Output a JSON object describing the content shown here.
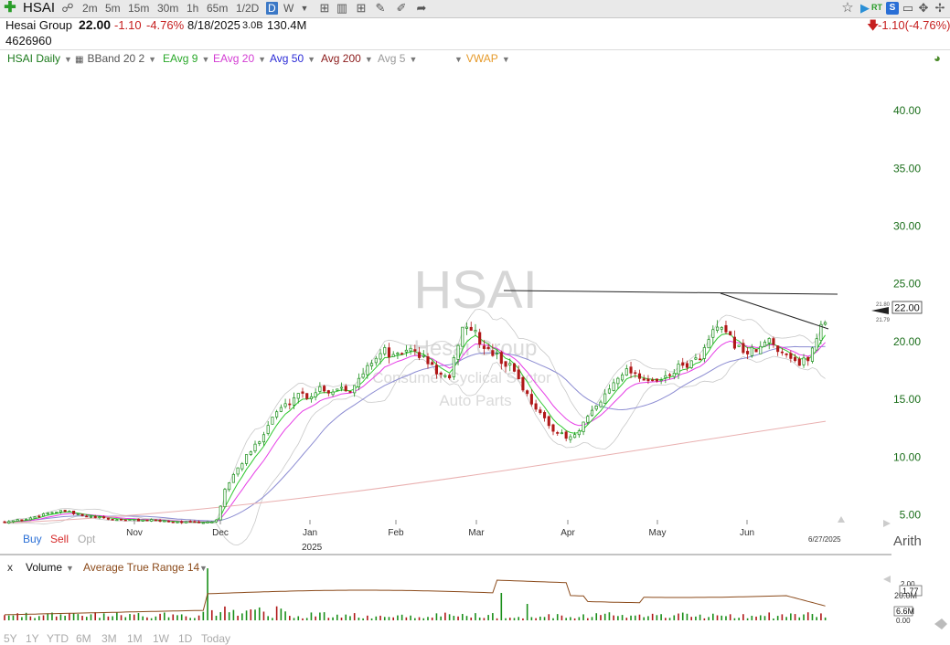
{
  "toolbar": {
    "symbol": "HSAI",
    "timeframes": [
      "2m",
      "5m",
      "15m",
      "30m",
      "1h",
      "65m",
      "1/2D",
      "D",
      "W"
    ],
    "selected_timeframe": "D",
    "rt_label": "RT",
    "sp_label": "S"
  },
  "quote": {
    "name": "Hesai Group",
    "price": "22.00",
    "change": "-1.10",
    "change_pct": "-4.76%",
    "date": "8/18/2025",
    "volume_short": "3.0B",
    "market_cap": "130.4M",
    "share_count": "4626960",
    "right_change": "-1.10(-4.76%)"
  },
  "indicators": {
    "symbol_label": "HSAI Daily",
    "bband": "BBand 20 2",
    "eavg9": "EAvg 9",
    "eavg20": "EAvg 20",
    "avg50": "Avg 50",
    "avg200": "Avg 200",
    "avg5": "Avg 5",
    "vwap": "VWAP"
  },
  "watermark": {
    "symbol": "HSAI",
    "name": "Hesai Group",
    "sector": "Consumer Cyclical Sector",
    "industry": "Auto Parts"
  },
  "chart_data": {
    "type": "candlestick",
    "scale": "Arith",
    "ylim": [
      3.7,
      42.5
    ],
    "y_ticks": [
      "40.00",
      "35.00",
      "30.00",
      "25.00",
      "20.00",
      "15.00",
      "10.00",
      "5.00"
    ],
    "x_ticks": [
      "Nov",
      "Dec",
      "Jan",
      "Feb",
      "Mar",
      "Apr",
      "May",
      "Jun"
    ],
    "year_label": "2025",
    "last_date": "6/27/2025",
    "price_tag": "22.00",
    "tag_high": "21.80",
    "tag_low": "21.79",
    "trendlines": [
      "resistance at about 23.1 (Mar to Jun)",
      "descending line from late May high to end of June"
    ],
    "colors": {
      "up": "#1a8f1a",
      "down": "#b01818",
      "ema9": "#2ec82e",
      "ema20": "#e63ce6",
      "sma50": "#8c8cd2",
      "sma200": "#e9b0b0",
      "bband": "#c8c8c8"
    }
  },
  "volume_panel": {
    "close_label": "x",
    "volume_label": "Volume",
    "atr_label": "Average True Range 14",
    "vol_tick": "20.0M",
    "vol_last": "6.6M",
    "vol_zero": "0.00",
    "atr_top": "2.00",
    "atr_last": "1.77"
  },
  "actions": {
    "buy": "Buy",
    "sell": "Sell",
    "opt": "Opt"
  },
  "ranges": [
    "5Y",
    "1Y",
    "YTD",
    "6M",
    "3M",
    "1M",
    "1W",
    "1D",
    "Today"
  ]
}
